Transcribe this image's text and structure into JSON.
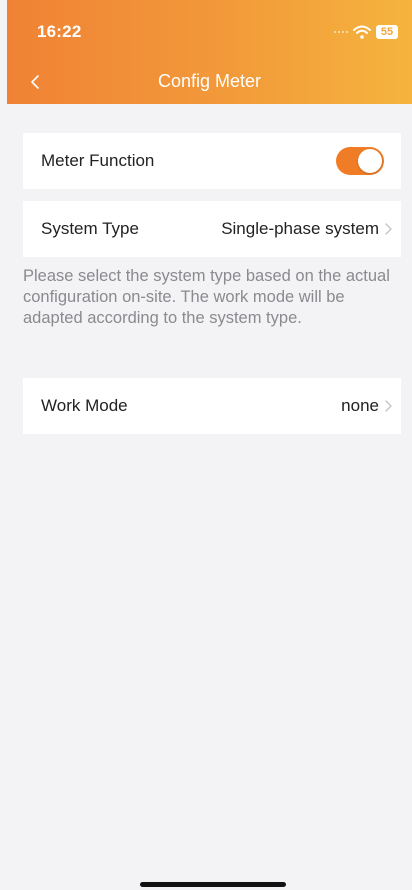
{
  "status_bar": {
    "time": "16:22",
    "battery": "55",
    "icons": [
      "signal-icon",
      "wifi-icon",
      "battery-icon"
    ]
  },
  "nav": {
    "title": "Config Meter",
    "back_icon": "chevron-left-icon"
  },
  "rows": {
    "meter_function": {
      "label": "Meter Function",
      "enabled": true
    },
    "system_type": {
      "label": "System Type",
      "value": "Single-phase system"
    },
    "work_mode": {
      "label": "Work Mode",
      "value": "none"
    }
  },
  "hint": "Please select the system type based on the actual configuration on-site. The work mode will be adapted according to the system type.",
  "colors": {
    "header_start": "#f08235",
    "header_end": "#f5b43d",
    "toggle_on": "#f07d26",
    "background": "#f3f3f5",
    "hint_text": "#8a8a8f"
  }
}
